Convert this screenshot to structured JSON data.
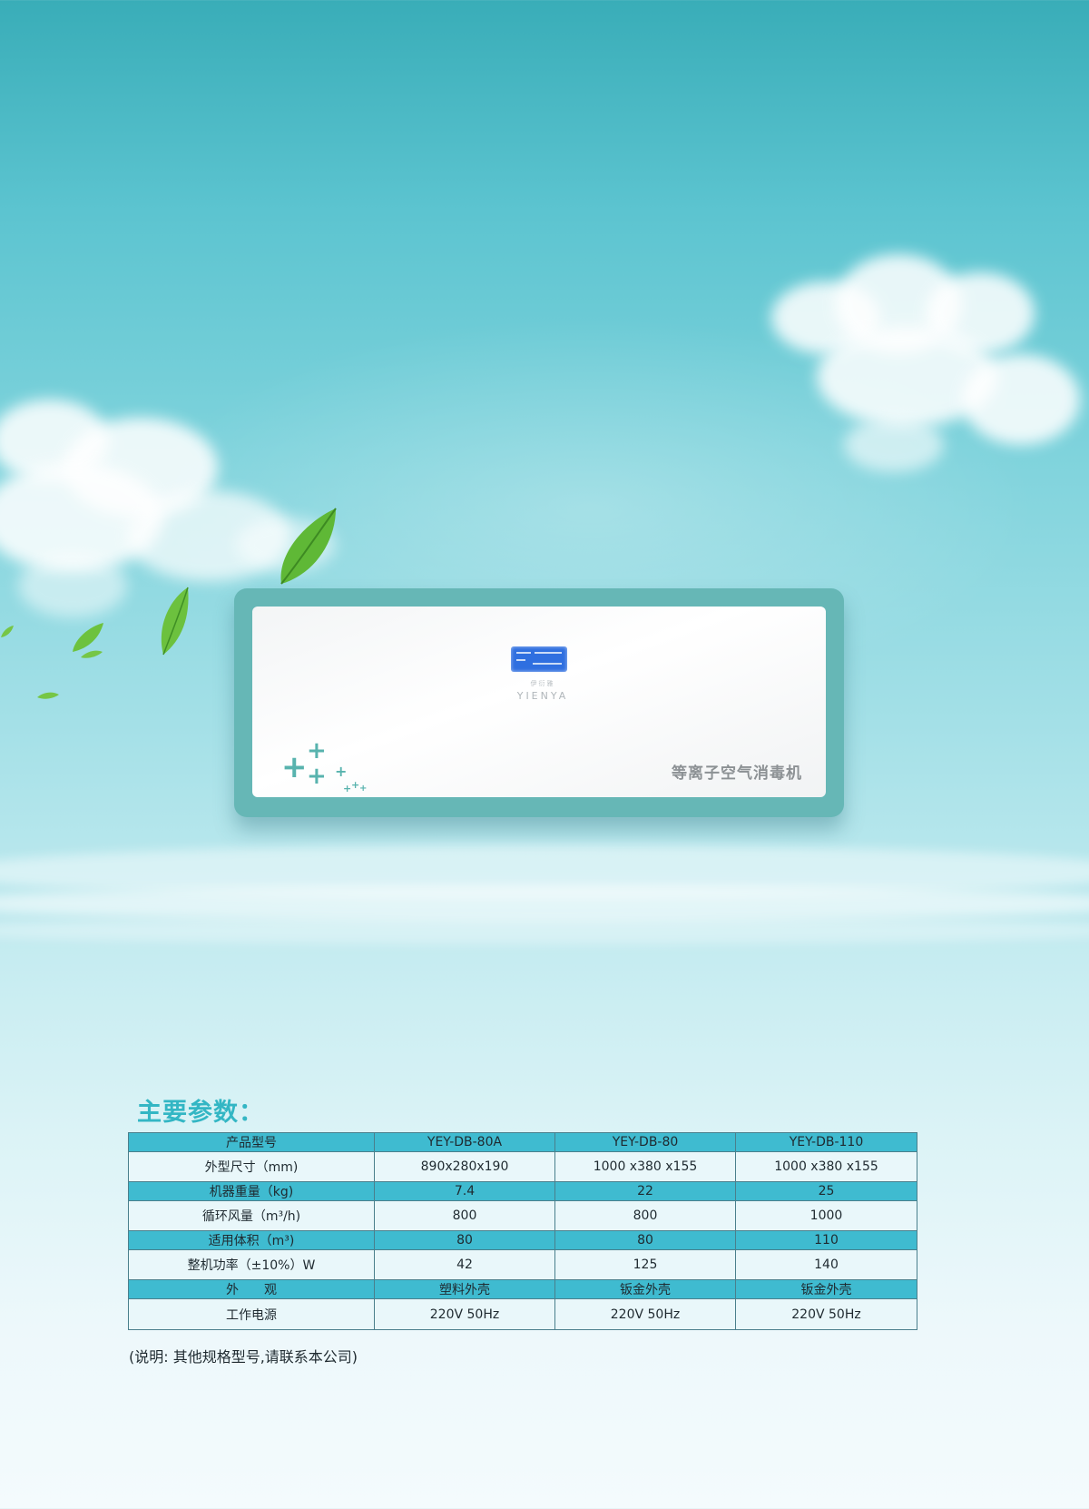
{
  "device": {
    "brand_cn": "伊衍雅",
    "brand_en": "YIENYA",
    "product_name": "等离子空气消毒机"
  },
  "spec": {
    "title": "主要参数：",
    "rows": [
      {
        "label": "产品型号",
        "values": [
          "YEY-DB-80A",
          "YEY-DB-80",
          "YEY-DB-110"
        ]
      },
      {
        "label": "外型尺寸（mm)",
        "values": [
          "890x280x190",
          "1000 x380 x155",
          "1000 x380 x155"
        ]
      },
      {
        "label": "机器重量（kg)",
        "values": [
          "7.4",
          "22",
          "25"
        ]
      },
      {
        "label": "循环风量（m³/h)",
        "values": [
          "800",
          "800",
          "1000"
        ]
      },
      {
        "label": "适用体积（m³)",
        "values": [
          "80",
          "80",
          "110"
        ]
      },
      {
        "label": "整机功率（±10%）W",
        "values": [
          "42",
          "125",
          "140"
        ]
      },
      {
        "label": "外　　观",
        "values": [
          "塑料外壳",
          "钣金外壳",
          "钣金外壳"
        ]
      },
      {
        "label": "工作电源",
        "values": [
          "220V  50Hz",
          "220V  50Hz",
          "220V  50Hz"
        ]
      }
    ],
    "note": "(说明: 其他规格型号,请联系本公司)"
  },
  "colors": {
    "accent": "#33b6c4",
    "table_header": "#3fbbd0",
    "device_frame": "#66b7b6"
  }
}
